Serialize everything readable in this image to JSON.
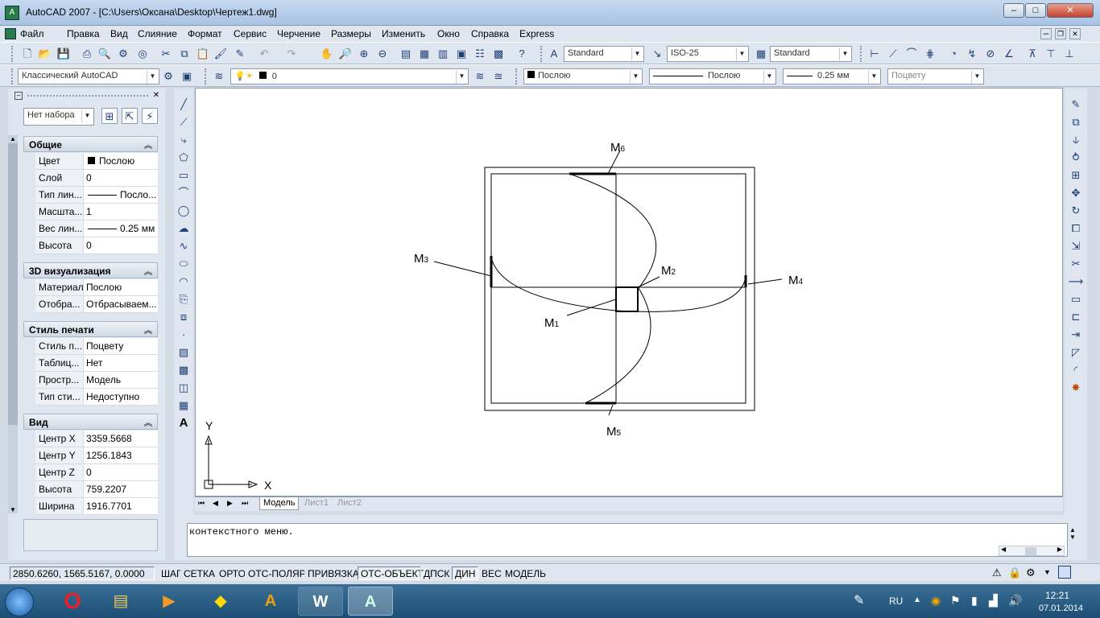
{
  "window": {
    "title": "AutoCAD 2007 - [C:\\Users\\Оксана\\Desktop\\Чертеж1.dwg]",
    "app_icon": "autocad-icon"
  },
  "menu": [
    "Файл",
    "Правка",
    "Вид",
    "Слияние",
    "Формат",
    "Сервис",
    "Черчение",
    "Размеры",
    "Изменить",
    "Окно",
    "Справка",
    "Express"
  ],
  "toolbar": {
    "text_style": "Standard",
    "dim_style": "ISO-25",
    "table_style": "Standard",
    "workspace": "Классический AutoCAD",
    "layer": "0",
    "color": "Послою",
    "linetype": "Послою",
    "lineweight": "0.25 мм",
    "plotstyle": "Поцвету"
  },
  "properties": {
    "selection": "Нет набора",
    "sections": {
      "general": {
        "title": "Общие",
        "rows": [
          {
            "k": "Цвет",
            "v": "Послою"
          },
          {
            "k": "Слой",
            "v": "0"
          },
          {
            "k": "Тип лин...",
            "v": "Посло..."
          },
          {
            "k": "Масшта...",
            "v": "1"
          },
          {
            "k": "Вес лин...",
            "v": "0.25 мм"
          },
          {
            "k": "Высота",
            "v": "0"
          }
        ]
      },
      "viz3d": {
        "title": "3D визуализация",
        "rows": [
          {
            "k": "Материал",
            "v": "Послою"
          },
          {
            "k": "Отобра...",
            "v": "Отбрасываем..."
          }
        ]
      },
      "plot": {
        "title": "Стиль печати",
        "rows": [
          {
            "k": "Стиль п...",
            "v": "Поцвету"
          },
          {
            "k": "Таблиц...",
            "v": "Нет"
          },
          {
            "k": "Простр...",
            "v": "Модель"
          },
          {
            "k": "Тип сти...",
            "v": "Недоступно"
          }
        ]
      },
      "view": {
        "title": "Вид",
        "rows": [
          {
            "k": "Центр X",
            "v": "3359.5668"
          },
          {
            "k": "Центр Y",
            "v": "1256.1843"
          },
          {
            "k": "Центр Z",
            "v": "0"
          },
          {
            "k": "Высота",
            "v": "759.2207"
          },
          {
            "k": "Ширина",
            "v": "1916.7701"
          }
        ]
      }
    }
  },
  "drawing": {
    "labels": {
      "m1": "M",
      "m1s": "1",
      "m2": "M",
      "m2s": "2",
      "m3": "M",
      "m3s": "3",
      "m4": "M",
      "m4s": "4",
      "m5": "M",
      "m5s": "5",
      "m6": "M",
      "m6s": "6"
    },
    "ucs": {
      "x": "X",
      "y": "Y"
    }
  },
  "tabs": [
    "Модель",
    "Лист1",
    "Лист2"
  ],
  "command": {
    "text": "контекстного меню."
  },
  "status": {
    "coords": "2850.6260, 1565.5167, 0.0000",
    "buttons": [
      "ШАГ",
      "СЕТКА",
      "ОРТО",
      "ОТС-ПОЛЯР",
      "ПРИВЯЗКА",
      "ОТС-ОБЪЕКТ",
      "ДПСК",
      "ДИН",
      "ВЕС",
      "МОДЕЛЬ"
    ]
  },
  "taskbar": {
    "lang": "RU",
    "time": "12:21",
    "date": "07.01.2014"
  }
}
